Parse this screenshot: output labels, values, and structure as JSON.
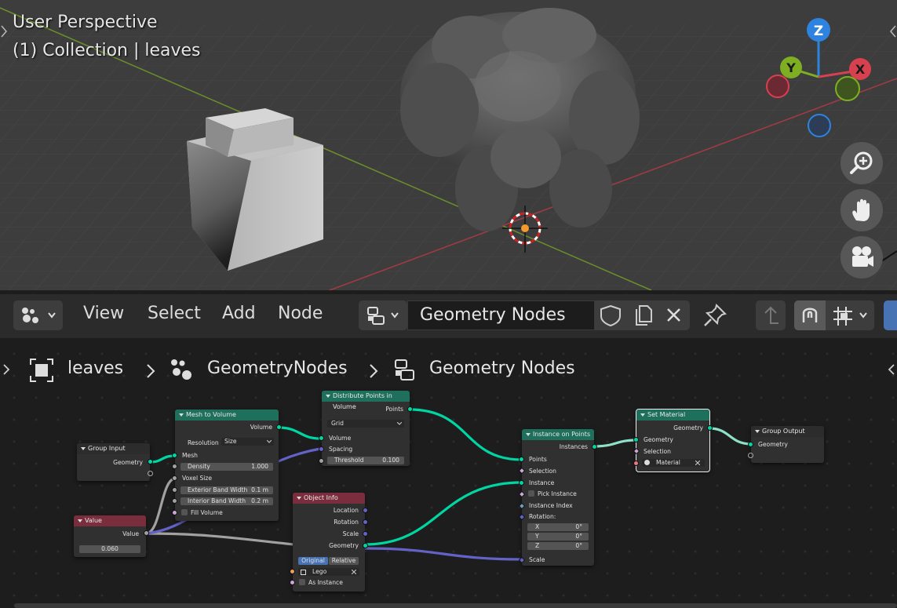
{
  "viewport": {
    "title": "User Perspective",
    "subtitle": "(1) Collection | leaves",
    "gizmo": {
      "z": "Z",
      "y": "Y",
      "x": "X"
    },
    "nav_icons": [
      "zoom-in-icon",
      "hand-pan-icon",
      "camera-icon"
    ]
  },
  "header": {
    "editor_type_icon": "geometry-nodes-editor-icon",
    "menu": {
      "view": "View",
      "select": "Select",
      "add": "Add",
      "node": "Node"
    },
    "node_tree_name": "Geometry Nodes"
  },
  "breadcrumb": {
    "object": "leaves",
    "modifier": "GeometryNodes",
    "tree": "Geometry Nodes"
  },
  "nodes": {
    "group_input": {
      "title": "Group Input",
      "geometry": "Geometry"
    },
    "value": {
      "title": "Value",
      "out": "Value",
      "val": "0.060"
    },
    "mesh_to_volume": {
      "title": "Mesh to Volume",
      "volume": "Volume",
      "resolution": "Resolution",
      "resolution_mode": "Size",
      "mesh": "Mesh",
      "density": "Density",
      "density_val": "1.000",
      "voxel_size": "Voxel Size",
      "ext_band": "Exterior Band Width",
      "ext_band_val": "0.1 m",
      "int_band": "Interior Band Width",
      "int_band_val": "0.2 m",
      "fill_volume": "Fill Volume"
    },
    "distribute": {
      "title": "Distribute Points in Volume",
      "points": "Points",
      "mode": "Grid",
      "volume": "Volume",
      "spacing": "Spacing",
      "threshold": "Threshold",
      "threshold_val": "0.100"
    },
    "object_info": {
      "title": "Object Info",
      "location": "Location",
      "rotation": "Rotation",
      "scale": "Scale",
      "geometry": "Geometry",
      "original": "Original",
      "relative": "Relative",
      "object": "Lego",
      "as_instance": "As Instance"
    },
    "instance_on_points": {
      "title": "Instance on Points",
      "instances": "Instances",
      "points": "Points",
      "selection": "Selection",
      "instance": "Instance",
      "pick_instance": "Pick Instance",
      "instance_index": "Instance Index",
      "rotation": "Rotation:",
      "x": "X",
      "y": "Y",
      "z": "Z",
      "rx": "0°",
      "ry": "0°",
      "rz": "0°",
      "scale": "Scale"
    },
    "set_material": {
      "title": "Set Material",
      "geometry_out": "Geometry",
      "geometry_in": "Geometry",
      "selection": "Selection",
      "material": "Material"
    },
    "group_output": {
      "title": "Group Output",
      "geometry": "Geometry"
    }
  },
  "colors": {
    "geometry_socket": "#00d6a3",
    "vector_socket": "#6363c7",
    "float_socket": "#a1a1a1",
    "geometry_header": "#1e6f5b",
    "input_header": "#7a2d3d",
    "accent_blue": "#4772b3"
  }
}
